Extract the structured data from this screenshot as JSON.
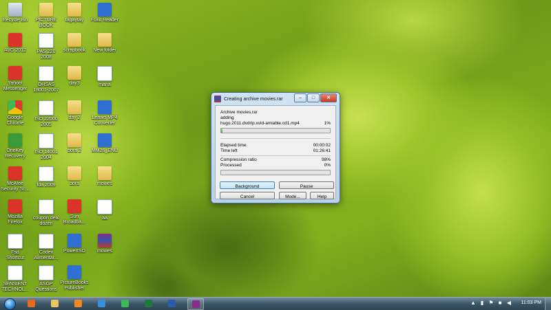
{
  "desktop_icons": [
    {
      "label": "Recycle Bin",
      "icon": "recycle-bin-icon"
    },
    {
      "label": "PICTURE\nBOOK",
      "icon": "folder-icon"
    },
    {
      "label": "tagaytay",
      "icon": "folder-icon"
    },
    {
      "label": "Foxit Reader",
      "icon": "pdf-reader-icon"
    },
    {
      "label": "AVG 2012",
      "icon": "antivirus-icon"
    },
    {
      "label": "PAS 220 2008",
      "icon": "document-icon"
    },
    {
      "label": "scrapbook",
      "icon": "folder-icon"
    },
    {
      "label": "New folder",
      "icon": "folder-icon"
    },
    {
      "label": "Yahoo!\nMessenger",
      "icon": "messenger-icon"
    },
    {
      "label": "OHSAS\n18001-2007",
      "icon": "document-icon"
    },
    {
      "label": "day3",
      "icon": "folder-icon"
    },
    {
      "label": "maria",
      "icon": "spreadsheet-icon"
    },
    {
      "label": "Google\nChrome",
      "icon": "chrome-icon"
    },
    {
      "label": "ISO 22000\n2005",
      "icon": "document-icon"
    },
    {
      "label": "day 2",
      "icon": "folder-icon"
    },
    {
      "label": "Leawo MP4\nConverter",
      "icon": "converter-icon"
    },
    {
      "label": "OneKey\nRecovery",
      "icon": "recovery-icon"
    },
    {
      "label": "ISO 14001\n2004",
      "icon": "document-icon"
    },
    {
      "label": "bora 2",
      "icon": "folder-icon"
    },
    {
      "label": "MM26_ENU",
      "icon": "installer-icon"
    },
    {
      "label": "McAfee\nSecurity Sc...",
      "icon": "mcafee-icon"
    },
    {
      "label": "fda 2009",
      "icon": "document-icon"
    },
    {
      "label": "bora",
      "icon": "folder-icon"
    },
    {
      "label": "movies",
      "icon": "folder-icon"
    },
    {
      "label": "Mozilla\nFirefox",
      "icon": "firefox-icon"
    },
    {
      "label": "coupon deal\ndozen",
      "icon": "document-icon"
    },
    {
      "label": "Sun\nBroadba...",
      "icon": "broadband-icon"
    },
    {
      "label": "aa",
      "icon": "spreadsheet-icon"
    },
    {
      "label": "Fsd\nShortcut",
      "icon": "shortcut-icon"
    },
    {
      "label": "Codex\nAlimentar...",
      "icon": "document-icon"
    },
    {
      "label": "PowerISO",
      "icon": "poweriso-icon"
    },
    {
      "label": "movies",
      "icon": "winrar-icon"
    },
    {
      "label": "SENSIENT\nTECHNOL...",
      "icon": "document-icon"
    },
    {
      "label": "ASGP\nQuestions",
      "icon": "document-icon"
    },
    {
      "label": "PictureBooks\nPublisher",
      "icon": "publisher-icon"
    }
  ],
  "dialog": {
    "title": "Creating archive movies.rar",
    "archive_line": "Archive movies.rar",
    "action": "adding",
    "file": "hugo.2011.dvdrip.xvid-amiable.cd1.mp4",
    "file_percent": "1%",
    "file_progress": 0.01,
    "elapsed_label": "Elapsed time",
    "elapsed_value": "00:00:02",
    "left_label": "Time left",
    "left_value": "01:26:41",
    "ratio_label": "Compression ratio",
    "ratio_value": "98%",
    "processed_label": "Processed",
    "processed_value": "0%",
    "processed_progress": 0.0,
    "buttons": {
      "background": "Background",
      "pause": "Pause",
      "cancel": "Cancel",
      "mode": "Mode...",
      "help": "Help"
    }
  },
  "taskbar": {
    "clock": "11:03 PM",
    "items": [
      "firefox-icon",
      "explorer-icon",
      "media-player-icon",
      "ie-icon",
      "chrome-icon",
      "excel-icon",
      "word-icon",
      "winrar-icon"
    ]
  }
}
